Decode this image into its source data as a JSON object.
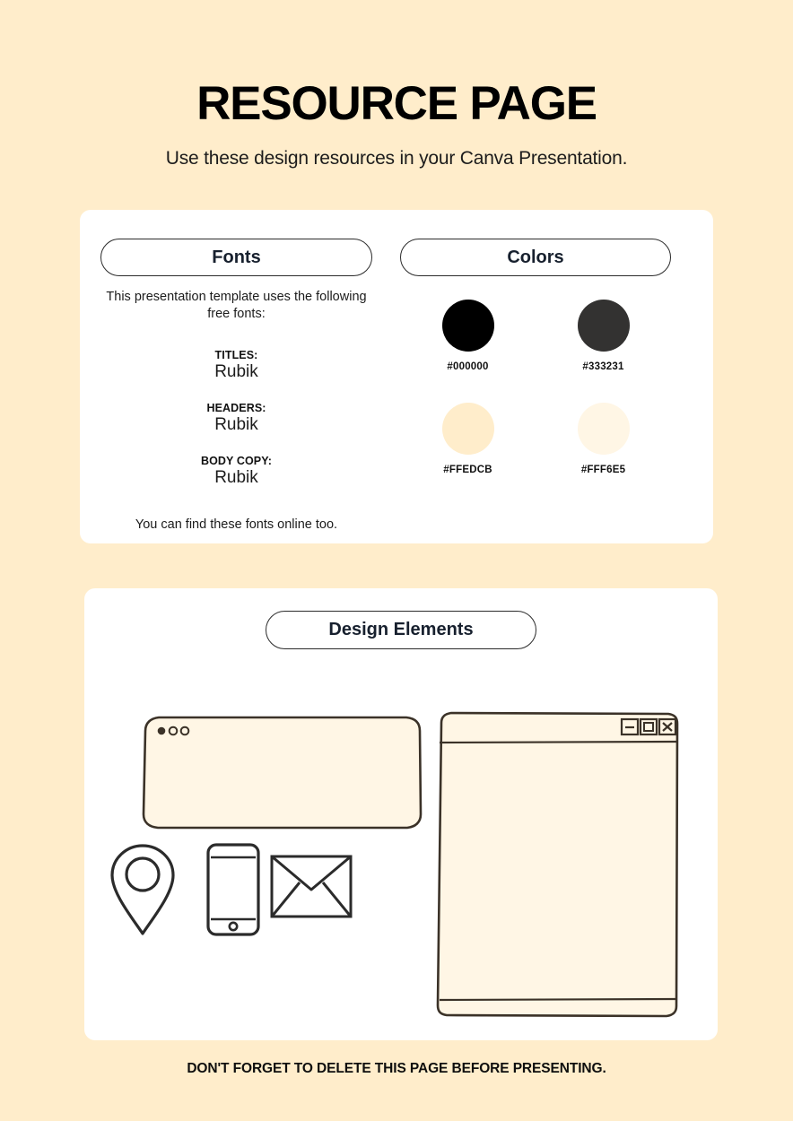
{
  "header": {
    "title": "RESOURCE PAGE",
    "subtitle": "Use these design resources in your Canva Presentation."
  },
  "fonts_panel": {
    "pill_label": "Fonts",
    "intro": "This presentation template uses the following free fonts:",
    "groups": [
      {
        "role": "TITLES:",
        "name": "Rubik"
      },
      {
        "role": "HEADERS:",
        "name": "Rubik"
      },
      {
        "role": "BODY COPY:",
        "name": "Rubik"
      }
    ],
    "outro": "You can find these fonts online too."
  },
  "colors_panel": {
    "pill_label": "Colors",
    "swatches": [
      {
        "hex": "#000000",
        "label": "#000000"
      },
      {
        "hex": "#333231",
        "label": "#333231"
      },
      {
        "hex": "#FFEDCB",
        "label": "#FFEDCB"
      },
      {
        "hex": "#FFF6E5",
        "label": "#FFF6E5"
      }
    ]
  },
  "design_panel": {
    "pill_label": "Design Elements",
    "elements": [
      "browser-window-rounded",
      "map-pin-icon",
      "smartphone-icon",
      "envelope-icon",
      "classic-window-frame"
    ]
  },
  "footer": {
    "note": "DON'T FORGET TO DELETE THIS PAGE BEFORE PRESENTING."
  },
  "theme": {
    "background": "#FFEDCB",
    "card": "#FFFFFF",
    "ink": "#3B3228",
    "window_fill": "#FFF6E5"
  }
}
